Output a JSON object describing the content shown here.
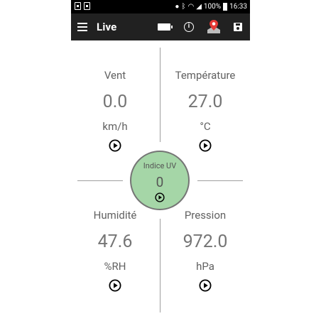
{
  "status_bar": {
    "battery_percent": "100%",
    "time": "16:33",
    "icons": [
      "image-icon",
      "notification-icon",
      "location-icon",
      "bluetooth-icon",
      "wifi-icon",
      "signal-icon",
      "battery-icon"
    ]
  },
  "app_bar": {
    "title": "Live",
    "actions": [
      "battery-icon",
      "info-icon",
      "map-marker-icon",
      "save-icon"
    ],
    "info_glyph": "i"
  },
  "readings": {
    "wind": {
      "label": "Vent",
      "value": "0.0",
      "unit": "km/h"
    },
    "temperature": {
      "label": "Température",
      "value": "27.0",
      "unit": "°C"
    },
    "uv": {
      "label": "Indice UV",
      "value": "0"
    },
    "humidity": {
      "label": "Humidité",
      "value": "47.6",
      "unit": "%RH"
    },
    "pressure": {
      "label": "Pression",
      "value": "972.0",
      "unit": "hPa"
    }
  },
  "colors": {
    "app_bar": "#212121",
    "uv_circle": "#a5d6a7",
    "text": "#616161",
    "divider": "#9e9e9e"
  }
}
